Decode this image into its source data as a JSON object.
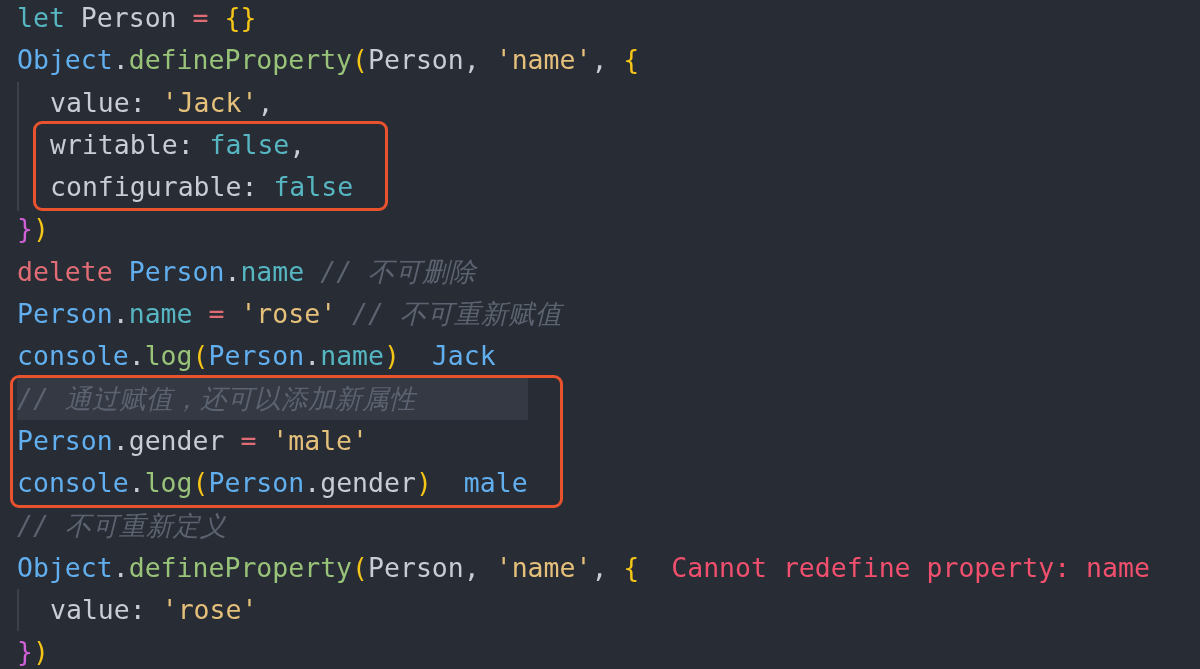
{
  "editor": {
    "blocks": [
      {
        "highlighted": false,
        "lines": [
          {
            "indented": false,
            "current": false,
            "tokens": [
              {
                "kind": "keyword",
                "text": "let"
              },
              {
                "kind": "plain",
                "text": " Person"
              },
              {
                "kind": "operator",
                "text": " ="
              },
              {
                "kind": "bracket",
                "text": " {}"
              }
            ]
          },
          {
            "indented": false,
            "current": false,
            "tokens": [
              {
                "kind": "variable",
                "text": "Object"
              },
              {
                "kind": "plain",
                "text": "."
              },
              {
                "kind": "function",
                "text": "defineProperty"
              },
              {
                "kind": "bracket",
                "text": "("
              },
              {
                "kind": "plain",
                "text": "Person,"
              },
              {
                "kind": "string",
                "text": " 'name'"
              },
              {
                "kind": "plain",
                "text": ","
              },
              {
                "kind": "bracket",
                "text": " {"
              }
            ]
          },
          {
            "indented": true,
            "current": false,
            "tokens": [
              {
                "kind": "plain",
                "text": "value:"
              },
              {
                "kind": "string",
                "text": " 'Jack'"
              },
              {
                "kind": "plain",
                "text": ","
              }
            ]
          }
        ]
      },
      {
        "highlighted": true,
        "lines": [
          {
            "indented": true,
            "current": false,
            "tokens": [
              {
                "kind": "plain",
                "text": "writable:"
              },
              {
                "kind": "literal",
                "text": " false"
              },
              {
                "kind": "plain",
                "text": ","
              }
            ]
          },
          {
            "indented": true,
            "current": false,
            "tokens": [
              {
                "kind": "plain",
                "text": "configurable:"
              },
              {
                "kind": "literal",
                "text": " false"
              }
            ]
          }
        ]
      },
      {
        "highlighted": false,
        "lines": [
          {
            "indented": false,
            "current": false,
            "tokens": [
              {
                "kind": "bracket2",
                "text": "}"
              },
              {
                "kind": "bracket",
                "text": ")"
              }
            ]
          },
          {
            "indented": false,
            "current": false,
            "tokens": [
              {
                "kind": "keyword2",
                "text": "delete"
              },
              {
                "kind": "variable",
                "text": " Person"
              },
              {
                "kind": "plain",
                "text": "."
              },
              {
                "kind": "property",
                "text": "name"
              },
              {
                "kind": "comment",
                "text": " // 不可删除"
              }
            ]
          },
          {
            "indented": false,
            "current": false,
            "tokens": [
              {
                "kind": "variable",
                "text": "Person"
              },
              {
                "kind": "plain",
                "text": "."
              },
              {
                "kind": "property",
                "text": "name"
              },
              {
                "kind": "operator",
                "text": " ="
              },
              {
                "kind": "string",
                "text": " 'rose'"
              },
              {
                "kind": "comment",
                "text": " // 不可重新赋值"
              }
            ]
          },
          {
            "indented": false,
            "current": false,
            "tokens": [
              {
                "kind": "variable",
                "text": "console"
              },
              {
                "kind": "plain",
                "text": "."
              },
              {
                "kind": "function",
                "text": "log"
              },
              {
                "kind": "bracket",
                "text": "("
              },
              {
                "kind": "variable",
                "text": "Person"
              },
              {
                "kind": "plain",
                "text": "."
              },
              {
                "kind": "property",
                "text": "name"
              },
              {
                "kind": "bracket",
                "text": ")"
              },
              {
                "kind": "output",
                "text": "  Jack"
              }
            ]
          }
        ]
      },
      {
        "highlighted": true,
        "lines": [
          {
            "indented": false,
            "current": true,
            "tokens": [
              {
                "kind": "comment",
                "text": "// 通过赋值，还可以添加新属性"
              }
            ]
          },
          {
            "indented": false,
            "current": false,
            "tokens": [
              {
                "kind": "variable",
                "text": "Person"
              },
              {
                "kind": "plain",
                "text": ".gender"
              },
              {
                "kind": "operator",
                "text": " ="
              },
              {
                "kind": "string",
                "text": " 'male'"
              }
            ]
          },
          {
            "indented": false,
            "current": false,
            "tokens": [
              {
                "kind": "variable",
                "text": "console"
              },
              {
                "kind": "plain",
                "text": "."
              },
              {
                "kind": "function",
                "text": "log"
              },
              {
                "kind": "bracket",
                "text": "("
              },
              {
                "kind": "variable",
                "text": "Person"
              },
              {
                "kind": "plain",
                "text": ".gender"
              },
              {
                "kind": "bracket",
                "text": ")"
              },
              {
                "kind": "output",
                "text": "  male"
              }
            ]
          }
        ]
      },
      {
        "highlighted": false,
        "lines": [
          {
            "indented": false,
            "current": false,
            "tokens": [
              {
                "kind": "comment",
                "text": "// 不可重新定义"
              }
            ]
          },
          {
            "indented": false,
            "current": false,
            "tokens": [
              {
                "kind": "variable",
                "text": "Object"
              },
              {
                "kind": "plain",
                "text": "."
              },
              {
                "kind": "function",
                "text": "defineProperty"
              },
              {
                "kind": "bracket",
                "text": "("
              },
              {
                "kind": "plain",
                "text": "Person,"
              },
              {
                "kind": "string",
                "text": " 'name'"
              },
              {
                "kind": "plain",
                "text": ","
              },
              {
                "kind": "bracket",
                "text": " {"
              },
              {
                "kind": "error",
                "text": "  Cannot redefine property: name"
              }
            ]
          },
          {
            "indented": true,
            "current": false,
            "tokens": [
              {
                "kind": "plain",
                "text": "value:"
              },
              {
                "kind": "string",
                "text": " 'rose'"
              }
            ]
          },
          {
            "indented": false,
            "current": false,
            "tokens": [
              {
                "kind": "bracket2",
                "text": "}"
              },
              {
                "kind": "bracket",
                "text": ")"
              }
            ]
          }
        ]
      }
    ]
  }
}
